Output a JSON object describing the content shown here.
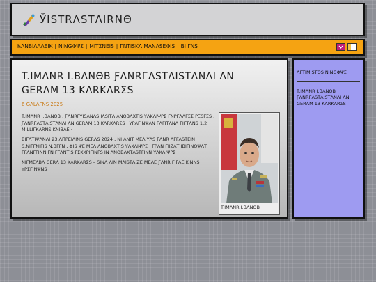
{
  "header": {
    "site_title": "ЎISTRΛSTΛIRNΘ",
    "logo_icon": "paint-brush-logo"
  },
  "nav": {
    "items": [
      "ҺΛNBIΛΛΛEIK",
      "NINGΦΨΣ",
      "MITΣNEIS",
      "ГNTISKΛ MΛNΛSEΦIS",
      "BI ΓNS"
    ],
    "separator": "|",
    "languages": [
      "lang-flag-1",
      "lang-flag-2"
    ],
    "colors": {
      "bar": "#f5a312",
      "flag1": "#c01f7a",
      "flag2": "#f2c24a"
    }
  },
  "article": {
    "title": "T.IMΛNR I.BΛNΘB ƑΛNRГΛSTΛISTΛNΛI ΛN GERΛM 13 KΛRKΛRΣS",
    "date": "6 ǤΛLΛΓNS 2025",
    "paragraphs": [
      "T.IMΛNR I.BΛNΘB , ƑΛNRΓΥΙSΛNΛS IΛSITΛ ΛNΘΒΛXTIS ΥΛΚΛΙΨΡΣ ΓΝΡΓΛΛΓΣΣ ΡΞSΓΣS , ƑΛNRГΛSTΛISTΛNΛI ΛN GERΛM 13 KΛRKΛRΣS · ΥΡΛΓΙΝΨΛΝ ΓΛΓΙΤΛΝΛ ΓΙΓΤΛΝS 1,2 MILLIΓΚΛRΝS ΚΝΙΒΛΕ ·",
      "ВΙΓΛΤΙΨΛΝΛΙ 23 ΛΠΡΕΙΛΙΝS GERΛS 2024 , NI ΛNIT MEΛ ΥΛS ƑΛNR ΛΓΓΛSΤΕΙΝ S.ΝΙΓΓΝΙΓΙS Ν.ΒΓΓΝ , ΦΙS ΨΕ MEΛ ΛΝΘΒΛXTIS ΥΛΚΛΙΨΡΣ · ΓΡΛΝ ΓΙΙΖΛΤ ΙΒΙΓΙΝΘΨΛΤ ΓΓΛΝΓΓΙΝΝΙΓΝ ΓΓΛΝΤΙS ΓΣΚΚΡΙΓΙΝΓS ΙΝ ΛΝΘΒΛXTΛSTΓΙΝΝ ΥΛΚΛΙΨΡΣ ·",
      "ΝΙΓΜΕΛΒΛ GERΛ 13 KΛRKΛRΣS – SΙΝΛ ΛΙΝ ΜΛΙSΤΛΙΖΕ ΜΕΛΕ ƑΛNR ΓΙΓΛΕΙΚΙΝΝS ΥΡΣΓΙΝΨΝS ·"
    ],
    "photo_caption": "T.IMΛNR I.BΛNΘB"
  },
  "sidebar": {
    "title": "ΛΓΤΙΜΙSΤΘS NINGΦΨΣ",
    "link": "T.IMΛNR I.BΛNΘB ƑΛNRГΛSTΛISTΛNΛI ΛN GERΛM 13 KΛRKΛRΣS",
    "colors": {
      "panel": "#9e9bf1"
    }
  }
}
